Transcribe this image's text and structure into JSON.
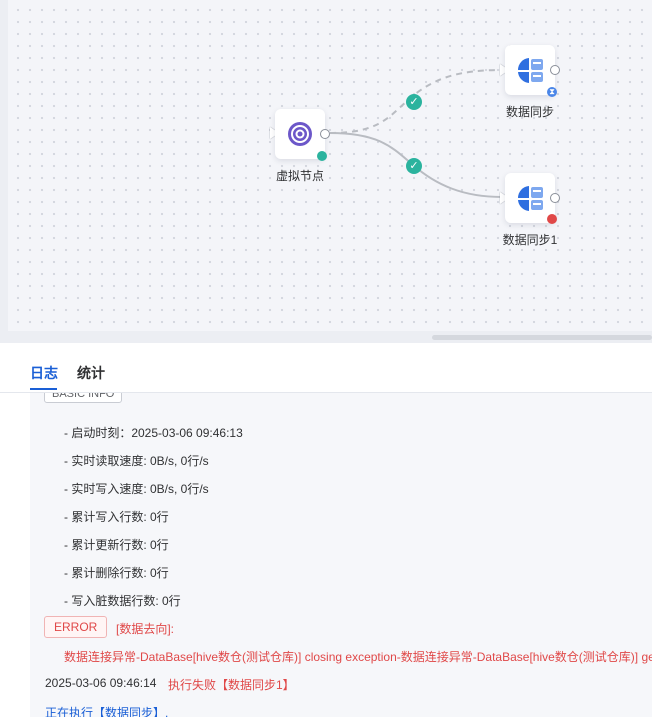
{
  "canvas": {
    "nodes": [
      {
        "id": "virtual",
        "label": "虚拟节点",
        "icon": "virtual-node-icon",
        "status": "success",
        "status_color": "#2bb39e"
      },
      {
        "id": "sync",
        "label": "数据同步",
        "icon": "data-sync-icon",
        "status": "waiting",
        "status_color": "#4a86e8"
      },
      {
        "id": "sync1",
        "label": "数据同步1",
        "icon": "data-sync-icon",
        "status": "failed",
        "status_color": "#e04848"
      }
    ],
    "edges": [
      {
        "from": "virtual",
        "to": "sync",
        "style": "dashed",
        "status": "success"
      },
      {
        "from": "virtual",
        "to": "sync1",
        "style": "solid",
        "status": "success"
      }
    ]
  },
  "tabs": [
    {
      "label": "日志",
      "active": true
    },
    {
      "label": "统计",
      "active": false
    }
  ],
  "log": {
    "basic_info_badge": "BASIC INFO",
    "stats": [
      "- 启动时刻：2025-03-06 09:46:13",
      "- 实时读取速度: 0B/s, 0行/s",
      "- 实时写入速度: 0B/s, 0行/s",
      "- 累计写入行数: 0行",
      "- 累计更新行数: 0行",
      "- 累计删除行数: 0行",
      "- 写入脏数据行数: 0行"
    ],
    "error_badge": "ERROR",
    "error_title": "[数据去向]:",
    "error_message": "数据连接异常-DataBase[hive数仓(测试仓库)] closing exception-数据连接异常-DataBase[hive数仓(测试仓库)] ge",
    "fail_timestamp": "2025-03-06 09:46:14",
    "fail_text": "执行失败【数据同步1】",
    "running_text": "正在执行【数据同步】."
  },
  "colors": {
    "accent": "#1a5fd6",
    "success": "#2bb39e",
    "error": "#e04848"
  }
}
